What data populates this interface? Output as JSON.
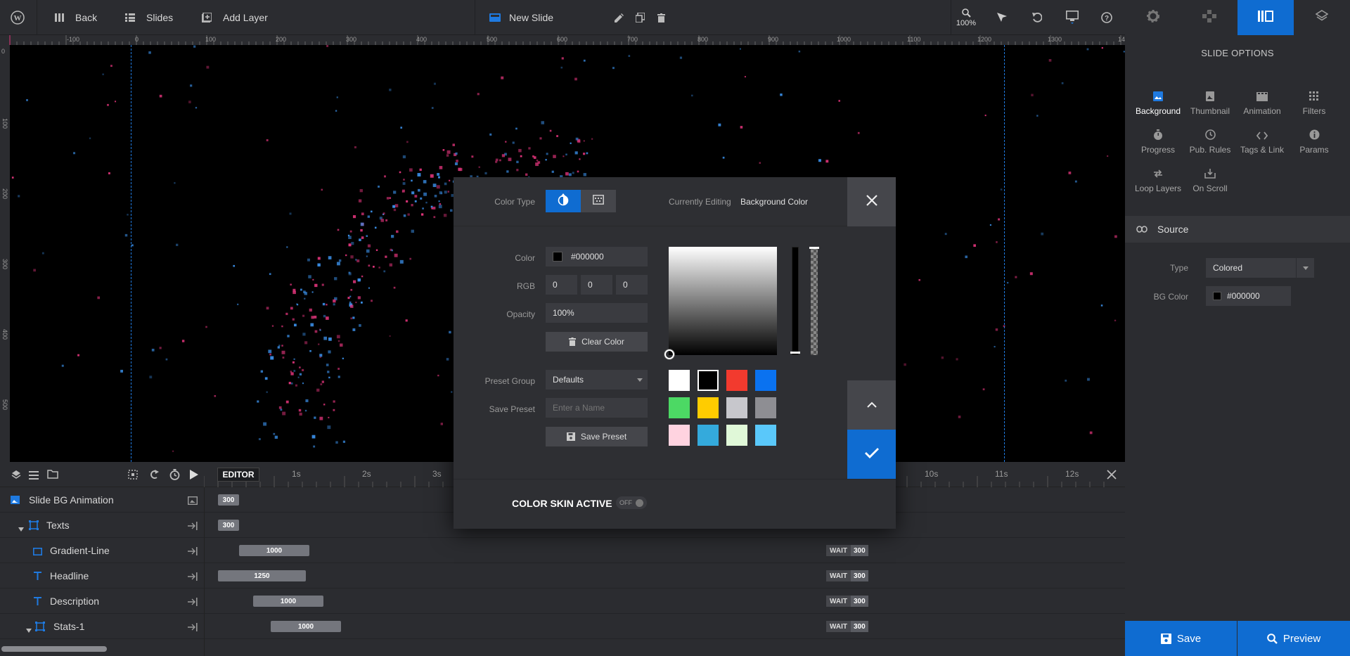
{
  "topbar": {
    "back_label": "Back",
    "slides_label": "Slides",
    "add_layer_label": "Add Layer",
    "slide_name": "New Slide",
    "zoom_label": "100%"
  },
  "ruler": {
    "labels": [
      "-100",
      "0",
      "100",
      "200",
      "300",
      "400",
      "500",
      "600",
      "700",
      "800",
      "900",
      "1000",
      "1100",
      "1200",
      "1300",
      "14"
    ],
    "v_labels": [
      "0",
      "100",
      "200",
      "300",
      "400",
      "500"
    ]
  },
  "right_panel": {
    "title": "SLIDE OPTIONS",
    "options": [
      {
        "label": "Background",
        "icon": "image-icon"
      },
      {
        "label": "Thumbnail",
        "icon": "thumbnail-icon"
      },
      {
        "label": "Animation",
        "icon": "film-icon"
      },
      {
        "label": "Filters",
        "icon": "grid-icon"
      },
      {
        "label": "Progress",
        "icon": "stopwatch-icon"
      },
      {
        "label": "Pub. Rules",
        "icon": "clock-icon"
      },
      {
        "label": "Tags & Link",
        "icon": "code-icon"
      },
      {
        "label": "Params",
        "icon": "info-icon"
      },
      {
        "label": "Loop Layers",
        "icon": "loop-icon"
      },
      {
        "label": "On Scroll",
        "icon": "download-icon"
      }
    ],
    "source_label": "Source",
    "type_label": "Type",
    "type_value": "Colored",
    "bgcolor_label": "BG Color",
    "bgcolor_value": "#000000",
    "save_label": "Save",
    "preview_label": "Preview"
  },
  "timeline": {
    "editor_label": "EDITOR",
    "ticks": [
      "1s",
      "2s",
      "3s",
      "10s",
      "11s",
      "12s"
    ],
    "rows": [
      {
        "name": "Slide BG Animation",
        "bar": "300"
      },
      {
        "name": "Texts",
        "bar": "300"
      },
      {
        "name": "Gradient-Line",
        "bar": "1000",
        "wait": "WAIT",
        "wait_val": "300"
      },
      {
        "name": "Headline",
        "bar": "1250",
        "wait": "WAIT",
        "wait_val": "300"
      },
      {
        "name": "Description",
        "bar": "1000",
        "wait": "WAIT",
        "wait_val": "300"
      },
      {
        "name": "Stats-1",
        "bar": "1000",
        "wait": "WAIT",
        "wait_val": "300"
      }
    ]
  },
  "color_dialog": {
    "color_type_label": "Color Type",
    "currently_editing_label": "Currently Editing",
    "currently_editing_value": "Background Color",
    "color_label": "Color",
    "color_value": "#000000",
    "rgb_label": "RGB",
    "r": "0",
    "g": "0",
    "b": "0",
    "opacity_label": "Opacity",
    "opacity_value": "100%",
    "clear_color_label": "Clear Color",
    "preset_group_label": "Preset Group",
    "preset_group_value": "Defaults",
    "save_preset_label": "Save Preset",
    "save_preset_placeholder": "Enter a Name",
    "save_preset_button": "Save Preset",
    "swatches": [
      "#ffffff",
      "#000000",
      "#f23a2e",
      "#0a72f0",
      "#4cd964",
      "#ffcc00",
      "#c7c7cc",
      "#8e8e93",
      "#ffd3e0",
      "#34aadc",
      "#e0f8d8",
      "#5ac8fa"
    ],
    "color_skin_label": "COLOR SKIN ACTIVE",
    "color_skin_state": "OFF"
  },
  "colors": {
    "accent": "#0f6cd1",
    "panel": "#2b2c30",
    "particle_pink": "#e0347a",
    "particle_blue": "#3a8ee6"
  }
}
